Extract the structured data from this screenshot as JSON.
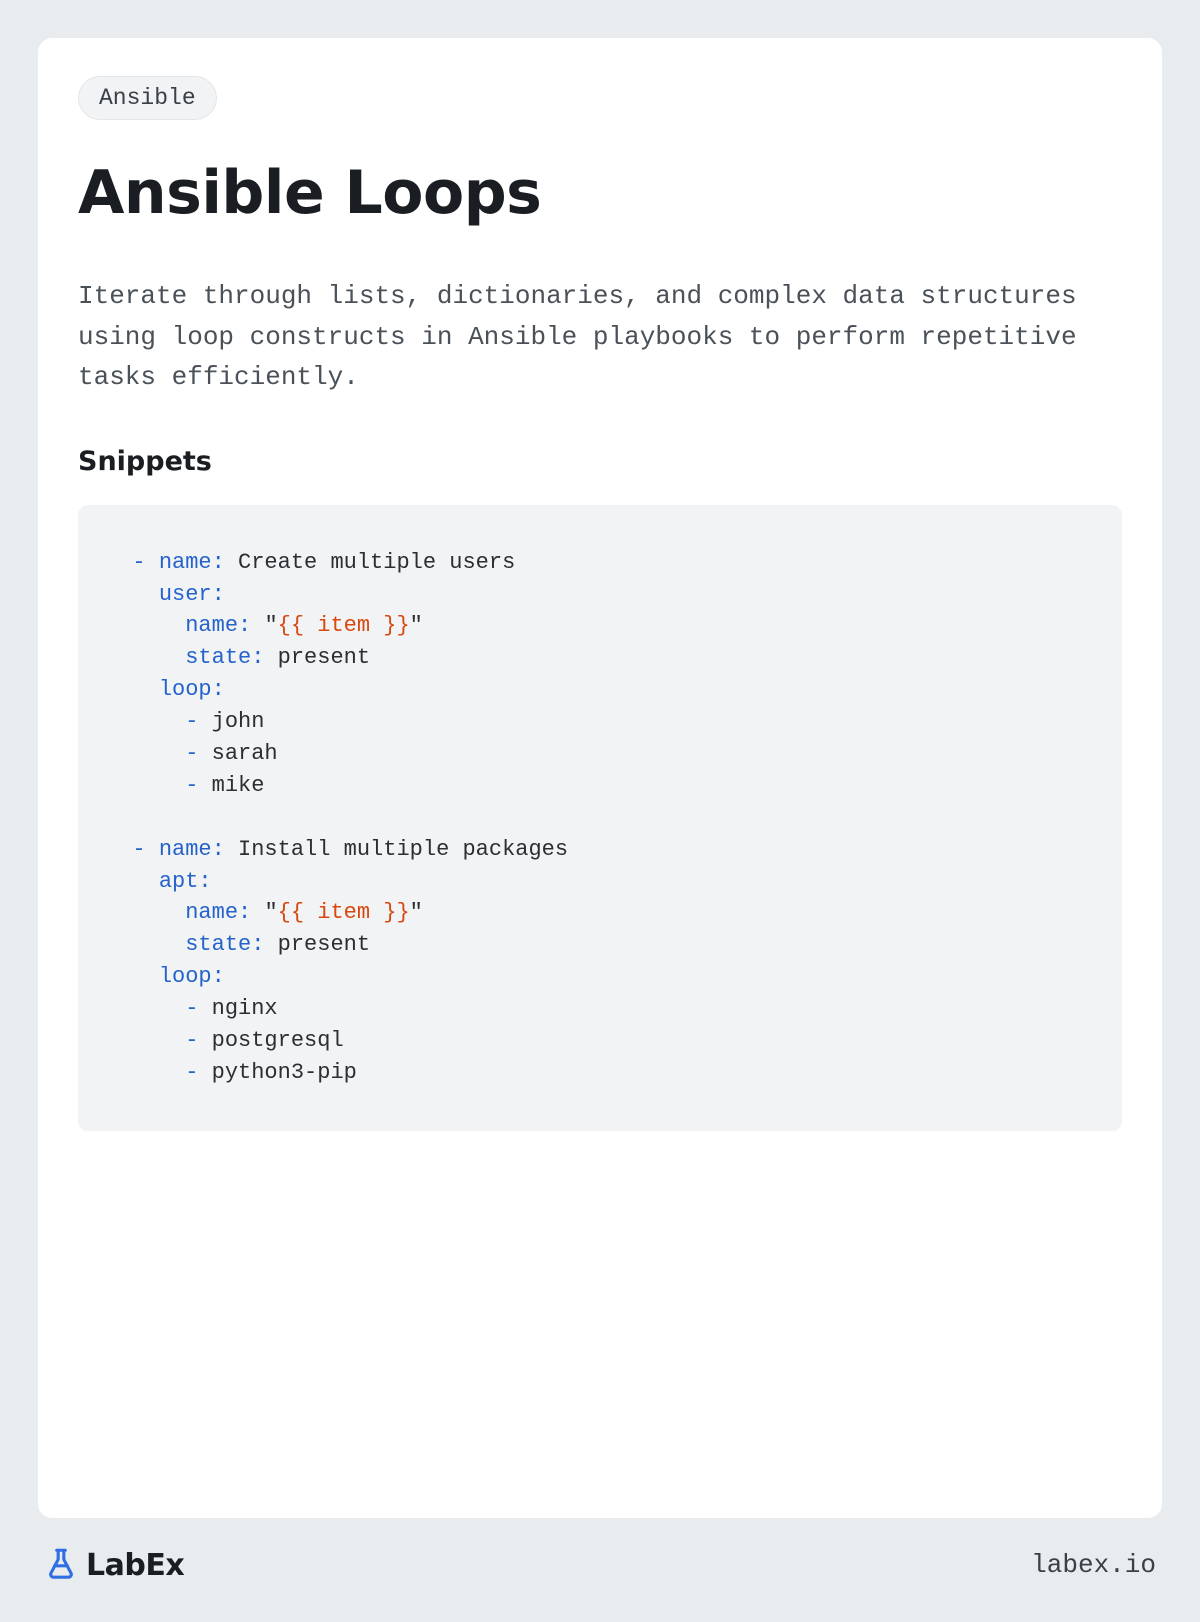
{
  "tag": "Ansible",
  "title": "Ansible Loops",
  "description": "Iterate through lists, dictionaries, and complex data structures using loop constructs in Ansible playbooks to perform repetitive tasks efficiently.",
  "snippets_heading": "Snippets",
  "code": {
    "task1": {
      "name_key": "name:",
      "name_val": "Create multiple users",
      "module": "user:",
      "prop_name_key": "name:",
      "prop_name_q1": "\"",
      "prop_name_tmpl": "{{ item }}",
      "prop_name_q2": "\"",
      "state_key": "state:",
      "state_val": "present",
      "loop_key": "loop:",
      "items": [
        "john",
        "sarah",
        "mike"
      ]
    },
    "task2": {
      "name_key": "name:",
      "name_val": "Install multiple packages",
      "module": "apt:",
      "prop_name_key": "name:",
      "prop_name_q1": "\"",
      "prop_name_tmpl": "{{ item }}",
      "prop_name_q2": "\"",
      "state_key": "state:",
      "state_val": "present",
      "loop_key": "loop:",
      "items": [
        "nginx",
        "postgresql",
        "python3-pip"
      ]
    }
  },
  "logo_text": "LabEx",
  "site_url": "labex.io"
}
